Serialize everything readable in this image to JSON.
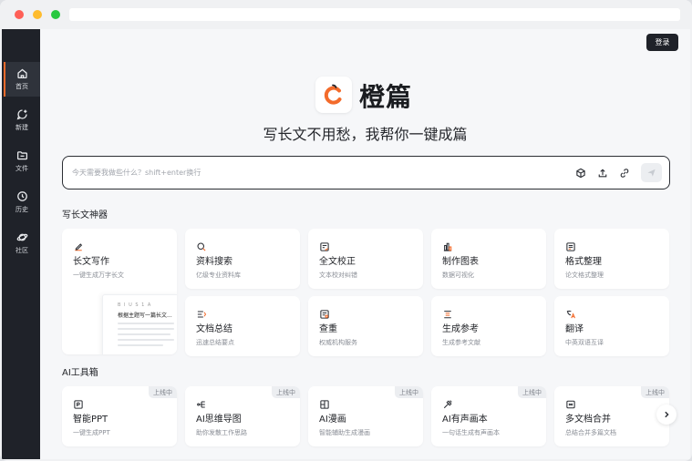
{
  "colors": {
    "accent": "#f36b2b",
    "sidebar": "#1f2229",
    "background": "#f6f7f9"
  },
  "sidebar": {
    "items": [
      {
        "label": "首页",
        "icon": "home-icon",
        "active": true
      },
      {
        "label": "新建",
        "icon": "new-chat-icon",
        "active": false
      },
      {
        "label": "文件",
        "icon": "folder-icon",
        "active": false
      },
      {
        "label": "历史",
        "icon": "clock-icon",
        "active": false
      },
      {
        "label": "社区",
        "icon": "planet-icon",
        "active": false
      }
    ]
  },
  "header": {
    "login_label": "登录"
  },
  "brand": {
    "name": "橙篇",
    "slogan": "写长文不用愁，我帮你一键成篇"
  },
  "search": {
    "placeholder": "今天需要我做些什么？shift+enter换行",
    "icons": [
      "cube-icon",
      "upload-icon",
      "link-icon",
      "send-icon"
    ]
  },
  "longform": {
    "title": "写长文神器",
    "cards": [
      {
        "title": "长文写作",
        "desc": "一键生成万字长文",
        "icon": "pen-icon"
      },
      {
        "title": "资料搜索",
        "desc": "亿级专业资料库",
        "icon": "search-icon"
      },
      {
        "title": "全文校正",
        "desc": "文本校对纠错",
        "icon": "proofread-icon"
      },
      {
        "title": "制作图表",
        "desc": "数据可视化",
        "icon": "chart-icon"
      },
      {
        "title": "格式整理",
        "desc": "论文格式整理",
        "icon": "format-icon"
      },
      {
        "title": "文档总结",
        "desc": "迅速总结要点",
        "icon": "summary-icon"
      },
      {
        "title": "查重",
        "desc": "权威机构服务",
        "icon": "duplicate-check-icon"
      },
      {
        "title": "生成参考",
        "desc": "生成参考文献",
        "icon": "reference-icon"
      },
      {
        "title": "翻译",
        "desc": "中英双语互译",
        "icon": "translate-icon"
      }
    ],
    "preview": {
      "toolbar": "B I U S 1 A",
      "title": "根据主题写一篇长文..."
    }
  },
  "ai_tools": {
    "title": "AI工具箱",
    "badge": "上线中",
    "cards": [
      {
        "title": "智能PPT",
        "desc": "一键生成PPT",
        "icon": "ppt-icon"
      },
      {
        "title": "AI思维导图",
        "desc": "助你发散工作思路",
        "icon": "mindmap-icon"
      },
      {
        "title": "AI漫画",
        "desc": "智能辅助生成漫画",
        "icon": "comic-icon"
      },
      {
        "title": "AI有声画本",
        "desc": "一句话生成有声画本",
        "icon": "audiobook-icon"
      },
      {
        "title": "多文档合并",
        "desc": "总结合并多篇文档",
        "icon": "merge-icon"
      }
    ]
  }
}
